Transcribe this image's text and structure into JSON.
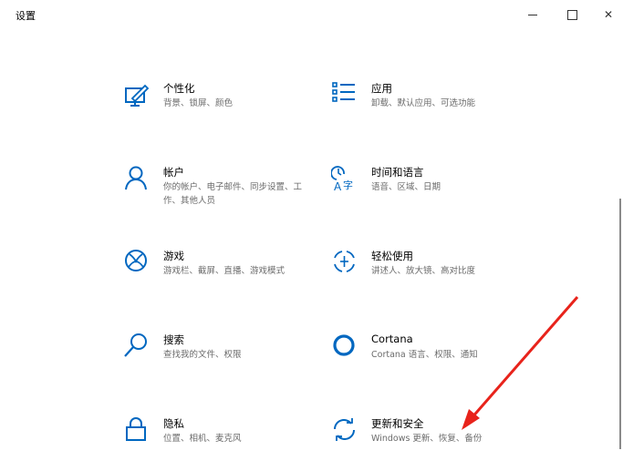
{
  "window": {
    "title": "设置",
    "minimize_glyph": "",
    "maximize_glyph": "",
    "close_glyph": "✕"
  },
  "tiles": [
    {
      "name": "个性化",
      "desc": "背景、锁屏、颜色",
      "icon": "personalization-icon"
    },
    {
      "name": "应用",
      "desc": "卸载、默认应用、可选功能",
      "icon": "apps-icon"
    },
    {
      "name": "帐户",
      "desc": "你的帐户、电子邮件、同步设置、工作、其他人员",
      "icon": "accounts-icon"
    },
    {
      "name": "时间和语言",
      "desc": "语音、区域、日期",
      "icon": "time-language-icon"
    },
    {
      "name": "游戏",
      "desc": "游戏栏、截屏、直播、游戏模式",
      "icon": "gaming-icon"
    },
    {
      "name": "轻松使用",
      "desc": "讲述人、放大镜、高对比度",
      "icon": "ease-of-access-icon"
    },
    {
      "name": "搜索",
      "desc": "查找我的文件、权限",
      "icon": "search-icon"
    },
    {
      "name": "Cortana",
      "desc": "Cortana 语言、权限、通知",
      "icon": "cortana-icon"
    },
    {
      "name": "隐私",
      "desc": "位置、相机、麦克风",
      "icon": "privacy-icon"
    },
    {
      "name": "更新和安全",
      "desc": "Windows 更新、恢复、备份",
      "icon": "update-security-icon"
    }
  ],
  "colors": {
    "accent": "#0067c0",
    "arrow": "#e8231b",
    "desc_text": "#6b6b6b"
  }
}
